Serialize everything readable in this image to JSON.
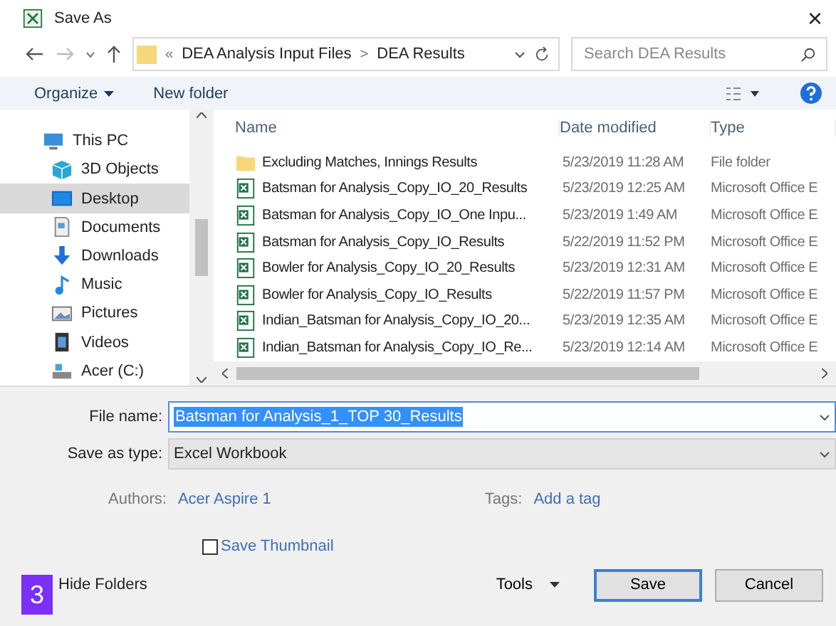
{
  "window": {
    "title": "Save As",
    "close": "×"
  },
  "nav": {
    "path_prefix": "«",
    "path": [
      "DEA Analysis Input Files",
      "DEA Results"
    ],
    "separator": ">",
    "search": {
      "placeholder": "Search DEA Results"
    }
  },
  "toolbar": {
    "organize": "Organize",
    "new_folder": "New folder"
  },
  "sidebar": {
    "items": [
      {
        "label": "This PC",
        "kind": "pc",
        "selected": false,
        "children": [
          {
            "label": "3D Objects",
            "kind": "cube",
            "selected": false
          },
          {
            "label": "Desktop",
            "kind": "desktop",
            "selected": true
          },
          {
            "label": "Documents",
            "kind": "document",
            "selected": false
          },
          {
            "label": "Downloads",
            "kind": "download",
            "selected": false
          },
          {
            "label": "Music",
            "kind": "music",
            "selected": false
          },
          {
            "label": "Pictures",
            "kind": "pictures",
            "selected": false
          },
          {
            "label": "Videos",
            "kind": "video",
            "selected": false
          },
          {
            "label": "Acer (C:)",
            "kind": "drive",
            "selected": false
          }
        ]
      }
    ]
  },
  "table": {
    "columns": [
      "Name",
      "Date modified",
      "Type"
    ],
    "rows": [
      {
        "kind": "folder",
        "name": "Excluding Matches, Innings Results",
        "date": "5/23/2019 11:28 AM",
        "type": "File folder"
      },
      {
        "kind": "excel",
        "name": "Batsman for Analysis_Copy_IO_20_Results",
        "date": "5/23/2019 12:25 AM",
        "type": "Microsoft Office E"
      },
      {
        "kind": "excel",
        "name": "Batsman for Analysis_Copy_IO_One Inpu...",
        "date": "5/23/2019 1:49 AM",
        "type": "Microsoft Office E"
      },
      {
        "kind": "excel",
        "name": "Batsman for Analysis_Copy_IO_Results",
        "date": "5/22/2019 11:52 PM",
        "type": "Microsoft Office E"
      },
      {
        "kind": "excel",
        "name": "Bowler for Analysis_Copy_IO_20_Results",
        "date": "5/23/2019 12:31 AM",
        "type": "Microsoft Office E"
      },
      {
        "kind": "excel",
        "name": "Bowler for Analysis_Copy_IO_Results",
        "date": "5/22/2019 11:57 PM",
        "type": "Microsoft Office E"
      },
      {
        "kind": "excel",
        "name": "Indian_Batsman for Analysis_Copy_IO_20...",
        "date": "5/23/2019 12:35 AM",
        "type": "Microsoft Office E"
      },
      {
        "kind": "excel",
        "name": "Indian_Batsman for Analysis_Copy_IO_Re...",
        "date": "5/23/2019 12:14 AM",
        "type": "Microsoft Office E"
      }
    ]
  },
  "form": {
    "file_name_label": "File name:",
    "file_name": "Batsman for Analysis_1_TOP 30_Results",
    "type_label": "Save as type:",
    "type": "Excel Workbook",
    "authors_label": "Authors:",
    "authors": "Acer Aspire 1",
    "tags_label": "Tags:",
    "tags": "Add a tag",
    "thumbnail": {
      "label": "Save Thumbnail",
      "checked": false
    }
  },
  "footer": {
    "step_badge": "3",
    "hide_folders": "Hide Folders",
    "tools": "Tools",
    "buttons": [
      "Save",
      "Cancel"
    ]
  }
}
